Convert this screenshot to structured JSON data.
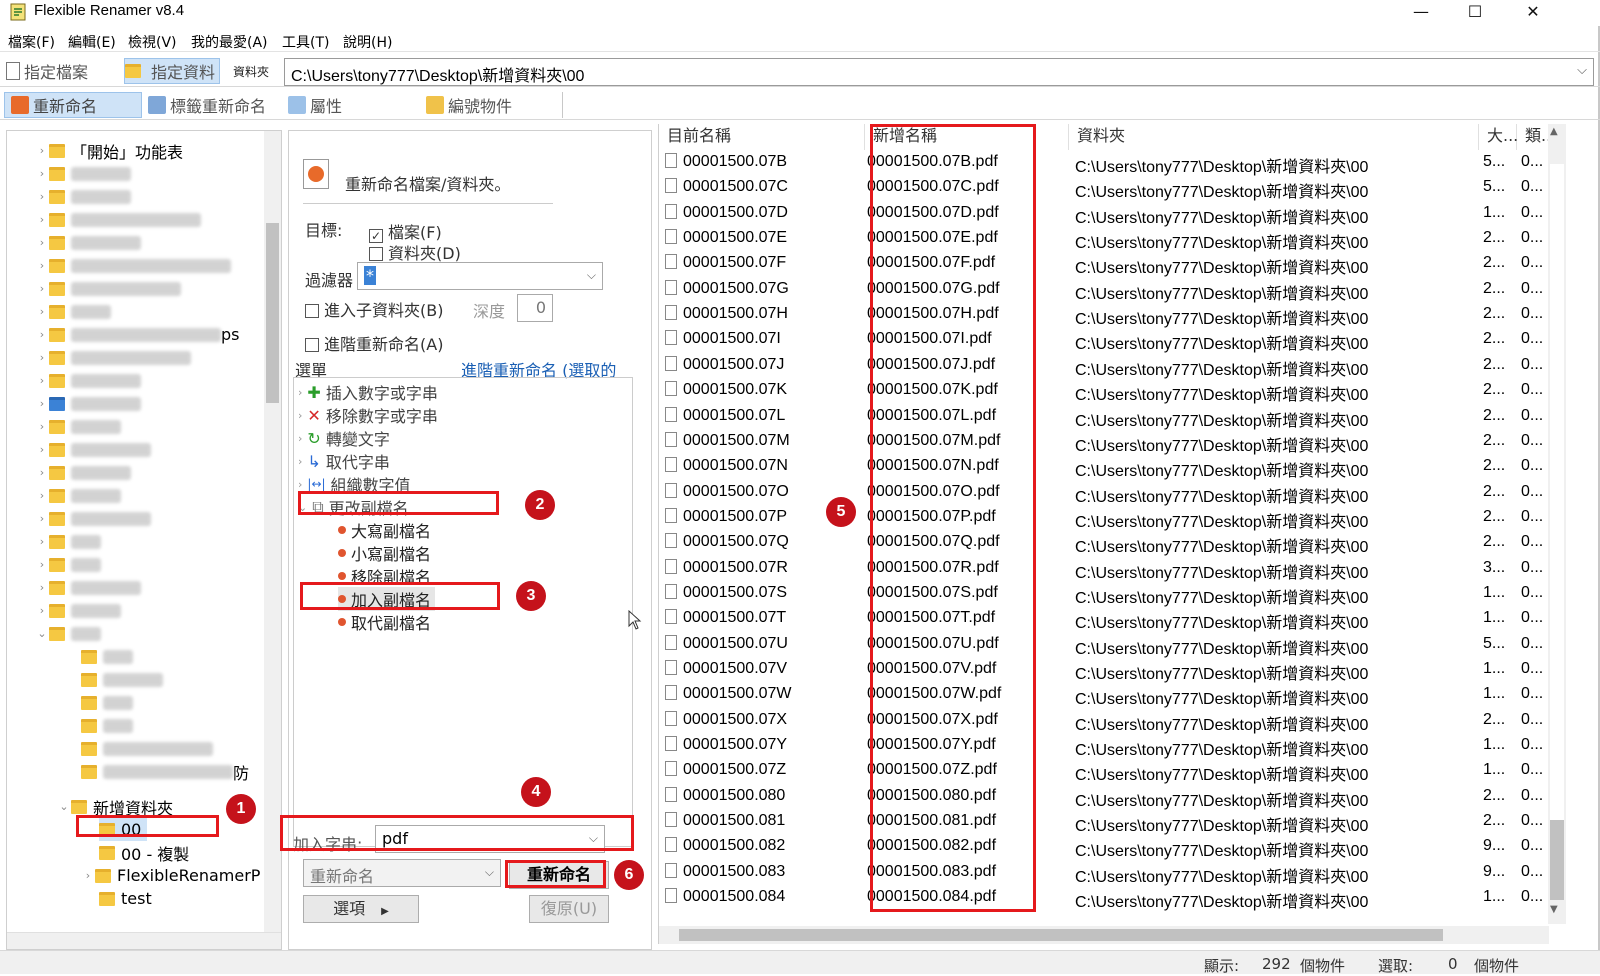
{
  "window": {
    "title": "Flexible Renamer v8.4",
    "minimize": "—",
    "maximize": "☐",
    "close": "✕"
  },
  "menu": [
    "檔案(F)",
    "編輯(E)",
    "檢視(V)",
    "我的最愛(A)",
    "工具(T)",
    "說明(H)"
  ],
  "toolbar": {
    "specify_files": "指定檔案",
    "specify_folder": "指定資料",
    "path_label": "資料夾",
    "path": "C:\\Users\\tony777\\Desktop\\新增資料夾\\00"
  },
  "tabs": [
    "重新命名",
    "標籤重新命名",
    "屬性",
    "編號物件"
  ],
  "tree": {
    "items": [
      {
        "label": "「開始」功能表",
        "level": 1
      },
      {
        "label": "",
        "level": 1
      },
      {
        "label": "",
        "level": 1
      },
      {
        "label": "",
        "level": 1
      },
      {
        "label": "",
        "level": 1
      },
      {
        "label": "",
        "level": 1
      },
      {
        "label": "",
        "level": 1
      },
      {
        "label": "",
        "level": 1
      },
      {
        "label": "ps",
        "level": 1
      }
    ],
    "new_folder": "新增資料夾",
    "folder_00": "00",
    "folder_00_copy": "00 - 複製",
    "folder_flexible": "FlexibleRenamerP",
    "folder_test": "test",
    "partial_text": "防"
  },
  "middle": {
    "header": "重新命名檔案/資料夾。",
    "target_label": "目標:",
    "files_checkbox": "檔案(F)",
    "folders_checkbox": "資料夾(D)",
    "filter_label": "過濾器",
    "filter_value": "*",
    "subfolders": "進入子資料夾(B)",
    "depth_label": "深度",
    "depth_value": "0",
    "advanced": "進階重新命名(A)",
    "menu_label": "選單",
    "advanced_link": "進階重新命名 (選取的",
    "operations": [
      {
        "label": "插入數字或字串",
        "icon": "plus-icon"
      },
      {
        "label": "移除數字或字串",
        "icon": "x-icon"
      },
      {
        "label": "轉變文字",
        "icon": "refresh-icon"
      },
      {
        "label": "取代字串",
        "icon": "replace-icon"
      },
      {
        "label": "組織數字值",
        "icon": "number-icon"
      },
      {
        "label": "更改副檔名",
        "icon": "extension-icon"
      }
    ],
    "ext_ops": [
      "大寫副檔名",
      "小寫副檔名",
      "移除副檔名",
      "加入副檔名",
      "取代副檔名"
    ],
    "add_string_label": "加入字串:",
    "add_string_value": "pdf",
    "rename_mode": "重新命名",
    "rename_button": "重新命名",
    "options_button": "選項",
    "undo_button": "復原(U)"
  },
  "file_list": {
    "columns": [
      "目前名稱",
      "新增名稱",
      "資料夾",
      "大...",
      "類..."
    ],
    "rows": [
      [
        "00001500.07B",
        "00001500.07B.pdf",
        "C:\\Users\\tony777\\Desktop\\新增資料夾\\00",
        "5...",
        "0..."
      ],
      [
        "00001500.07C",
        "00001500.07C.pdf",
        "C:\\Users\\tony777\\Desktop\\新增資料夾\\00",
        "5...",
        "0..."
      ],
      [
        "00001500.07D",
        "00001500.07D.pdf",
        "C:\\Users\\tony777\\Desktop\\新增資料夾\\00",
        "1...",
        "0..."
      ],
      [
        "00001500.07E",
        "00001500.07E.pdf",
        "C:\\Users\\tony777\\Desktop\\新增資料夾\\00",
        "2...",
        "0..."
      ],
      [
        "00001500.07F",
        "00001500.07F.pdf",
        "C:\\Users\\tony777\\Desktop\\新增資料夾\\00",
        "2...",
        "0..."
      ],
      [
        "00001500.07G",
        "00001500.07G.pdf",
        "C:\\Users\\tony777\\Desktop\\新增資料夾\\00",
        "2...",
        "0..."
      ],
      [
        "00001500.07H",
        "00001500.07H.pdf",
        "C:\\Users\\tony777\\Desktop\\新增資料夾\\00",
        "2...",
        "0..."
      ],
      [
        "00001500.07I",
        "00001500.07I.pdf",
        "C:\\Users\\tony777\\Desktop\\新增資料夾\\00",
        "2...",
        "0..."
      ],
      [
        "00001500.07J",
        "00001500.07J.pdf",
        "C:\\Users\\tony777\\Desktop\\新增資料夾\\00",
        "2...",
        "0..."
      ],
      [
        "00001500.07K",
        "00001500.07K.pdf",
        "C:\\Users\\tony777\\Desktop\\新增資料夾\\00",
        "2...",
        "0..."
      ],
      [
        "00001500.07L",
        "00001500.07L.pdf",
        "C:\\Users\\tony777\\Desktop\\新增資料夾\\00",
        "2...",
        "0..."
      ],
      [
        "00001500.07M",
        "00001500.07M.pdf",
        "C:\\Users\\tony777\\Desktop\\新增資料夾\\00",
        "2...",
        "0..."
      ],
      [
        "00001500.07N",
        "00001500.07N.pdf",
        "C:\\Users\\tony777\\Desktop\\新增資料夾\\00",
        "2...",
        "0..."
      ],
      [
        "00001500.07O",
        "00001500.07O.pdf",
        "C:\\Users\\tony777\\Desktop\\新增資料夾\\00",
        "2...",
        "0..."
      ],
      [
        "00001500.07P",
        "00001500.07P.pdf",
        "C:\\Users\\tony777\\Desktop\\新增資料夾\\00",
        "2...",
        "0..."
      ],
      [
        "00001500.07Q",
        "00001500.07Q.pdf",
        "C:\\Users\\tony777\\Desktop\\新增資料夾\\00",
        "2...",
        "0..."
      ],
      [
        "00001500.07R",
        "00001500.07R.pdf",
        "C:\\Users\\tony777\\Desktop\\新增資料夾\\00",
        "3...",
        "0..."
      ],
      [
        "00001500.07S",
        "00001500.07S.pdf",
        "C:\\Users\\tony777\\Desktop\\新增資料夾\\00",
        "1...",
        "0..."
      ],
      [
        "00001500.07T",
        "00001500.07T.pdf",
        "C:\\Users\\tony777\\Desktop\\新增資料夾\\00",
        "1...",
        "0..."
      ],
      [
        "00001500.07U",
        "00001500.07U.pdf",
        "C:\\Users\\tony777\\Desktop\\新增資料夾\\00",
        "5...",
        "0..."
      ],
      [
        "00001500.07V",
        "00001500.07V.pdf",
        "C:\\Users\\tony777\\Desktop\\新增資料夾\\00",
        "1...",
        "0..."
      ],
      [
        "00001500.07W",
        "00001500.07W.pdf",
        "C:\\Users\\tony777\\Desktop\\新增資料夾\\00",
        "1...",
        "0..."
      ],
      [
        "00001500.07X",
        "00001500.07X.pdf",
        "C:\\Users\\tony777\\Desktop\\新增資料夾\\00",
        "2...",
        "0..."
      ],
      [
        "00001500.07Y",
        "00001500.07Y.pdf",
        "C:\\Users\\tony777\\Desktop\\新增資料夾\\00",
        "1...",
        "0..."
      ],
      [
        "00001500.07Z",
        "00001500.07Z.pdf",
        "C:\\Users\\tony777\\Desktop\\新增資料夾\\00",
        "1...",
        "0..."
      ],
      [
        "00001500.080",
        "00001500.080.pdf",
        "C:\\Users\\tony777\\Desktop\\新增資料夾\\00",
        "2...",
        "0..."
      ],
      [
        "00001500.081",
        "00001500.081.pdf",
        "C:\\Users\\tony777\\Desktop\\新增資料夾\\00",
        "2...",
        "0..."
      ],
      [
        "00001500.082",
        "00001500.082.pdf",
        "C:\\Users\\tony777\\Desktop\\新增資料夾\\00",
        "9...",
        "0..."
      ],
      [
        "00001500.083",
        "00001500.083.pdf",
        "C:\\Users\\tony777\\Desktop\\新增資料夾\\00",
        "9...",
        "0..."
      ],
      [
        "00001500.084",
        "00001500.084.pdf",
        "C:\\Users\\tony777\\Desktop\\新增資料夾\\00",
        "1...",
        "0..."
      ]
    ]
  },
  "annotations": [
    "1",
    "2",
    "3",
    "4",
    "5",
    "6"
  ],
  "status": {
    "shown_label": "顯示:",
    "shown_count": "292",
    "shown_unit": "個物件",
    "selected_label": "選取:",
    "selected_count": "0",
    "selected_unit": "個物件"
  },
  "colors": {
    "annotation_red": "#e5191c",
    "badge_red": "#c5121b",
    "selection_blue": "#cfe3f7",
    "link_blue": "#1a5fb4"
  }
}
